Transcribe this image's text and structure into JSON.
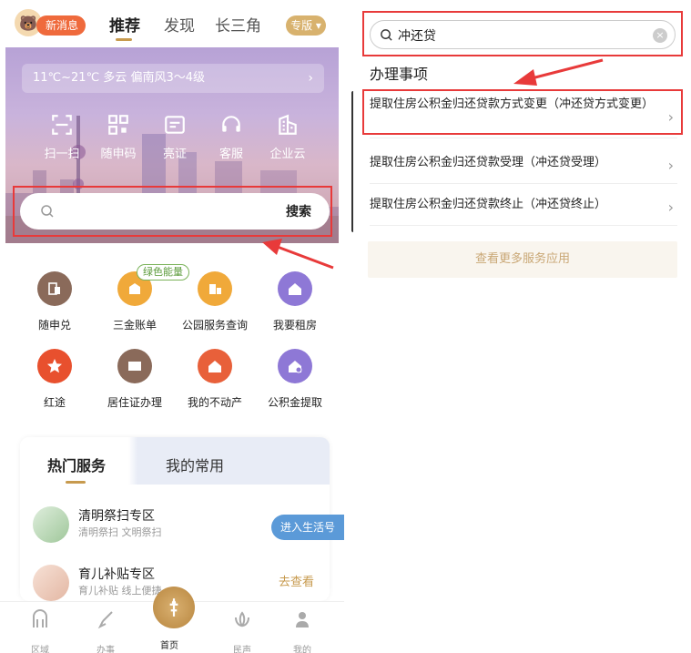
{
  "left": {
    "nav": {
      "new_message": "新消息",
      "tabs": [
        "推荐",
        "发现",
        "长三角"
      ],
      "special": "专版"
    },
    "weather": "11℃~21℃ 多云 偏南风3～4级",
    "quick_actions": [
      {
        "label": "扫一扫",
        "icon": "scan-icon"
      },
      {
        "label": "随申码",
        "icon": "qrcode-icon"
      },
      {
        "label": "亮证",
        "icon": "id-card-icon"
      },
      {
        "label": "客服",
        "icon": "headset-icon"
      },
      {
        "label": "企业云",
        "icon": "building-icon"
      }
    ],
    "search": {
      "button": "搜索"
    },
    "services": [
      {
        "label": "随申兑",
        "color": "#8a6a5a"
      },
      {
        "label": "三金账单",
        "color": "#f0a93a"
      },
      {
        "label": "公园服务查询",
        "color": "#f0a93a"
      },
      {
        "label": "我要租房",
        "color": "#8e78d6"
      },
      {
        "label": "红途",
        "color": "#e8502e"
      },
      {
        "label": "居住证办理",
        "color": "#8a6a5a"
      },
      {
        "label": "我的不动产",
        "color": "#e8603a"
      },
      {
        "label": "公积金提取",
        "color": "#8e78d6"
      }
    ],
    "green_tag": "绿色能量",
    "hot": {
      "tab_hot": "热门服务",
      "tab_mine": "我的常用",
      "rows": [
        {
          "title": "清明祭扫专区",
          "sub": "清明祭扫 文明祭扫"
        },
        {
          "title": "育儿补贴专区",
          "sub": "育儿补贴 线上便捷…"
        }
      ],
      "enter_btn": "进入生活号",
      "see_btn": "去查看"
    },
    "bottom_nav": [
      "区域",
      "办事",
      "首页",
      "民声",
      "我的"
    ]
  },
  "right": {
    "search_value": "冲还贷",
    "section_title": "办理事项",
    "items": [
      "提取住房公积金归还贷款方式变更（冲还贷方式变更）",
      "提取住房公积金归还贷款受理（冲还贷受理）",
      "提取住房公积金归还贷款终止（冲还贷终止）"
    ],
    "more_button": "查看更多服务应用"
  },
  "colors": {
    "highlight": "#e83a3a",
    "accent": "#c79a4e"
  }
}
